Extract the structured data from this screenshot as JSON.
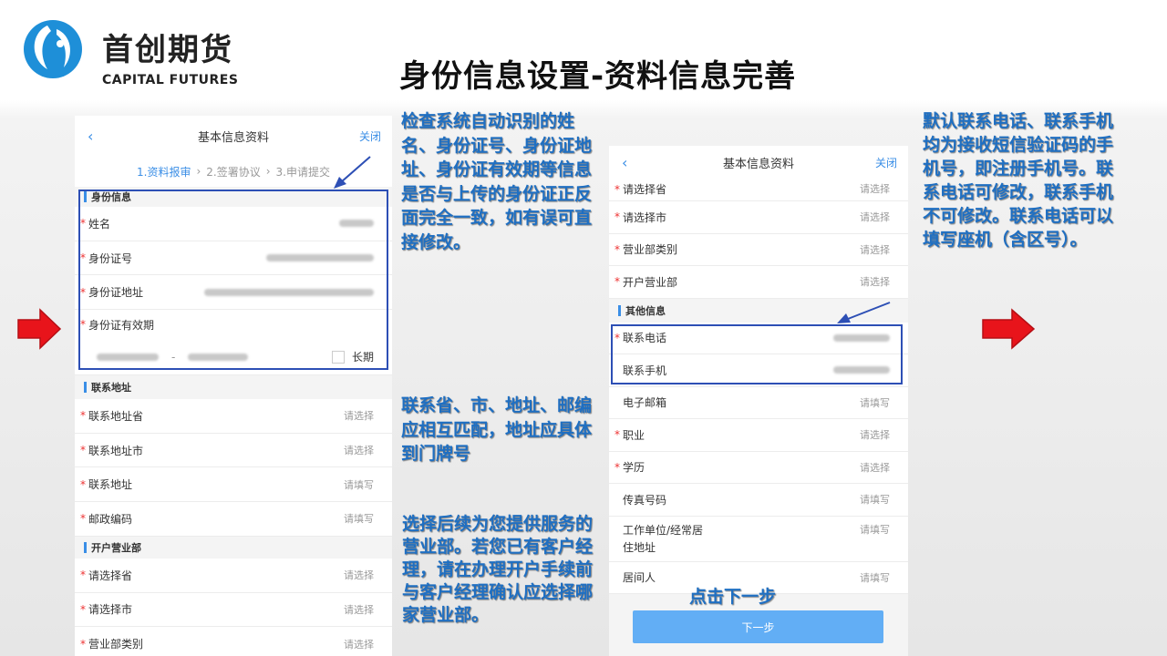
{
  "brand": {
    "name_cn": "首创期货",
    "name_en": "CAPITAL FUTURES"
  },
  "slide_title": "身份信息设置-资料信息完善",
  "phone_left": {
    "header": {
      "title": "基本信息资料",
      "close": "关闭"
    },
    "steps": [
      "1.资料报审",
      "2.签署协议",
      "3.申请提交"
    ],
    "identity_section": "身份信息",
    "identity_rows": [
      {
        "label": "姓名"
      },
      {
        "label": "身份证号"
      },
      {
        "label": "身份证地址"
      },
      {
        "label": "身份证有效期"
      }
    ],
    "long_term_label": "长期",
    "date_sep": "-",
    "contact_section": "联系地址",
    "contact_rows": [
      {
        "label": "联系地址省",
        "value": "请选择"
      },
      {
        "label": "联系地址市",
        "value": "请选择"
      },
      {
        "label": "联系地址",
        "value": "请填写"
      },
      {
        "label": "邮政编码",
        "value": "请填写"
      }
    ],
    "branch_section": "开户营业部",
    "branch_rows": [
      {
        "label": "请选择省",
        "value": "请选择"
      },
      {
        "label": "请选择市",
        "value": "请选择"
      },
      {
        "label": "营业部类别",
        "value": "请选择"
      }
    ]
  },
  "phone_right": {
    "header": {
      "title": "基本信息资料",
      "close": "关闭"
    },
    "top_rows": [
      {
        "label": "请选择省",
        "value": "请选择"
      },
      {
        "label": "请选择市",
        "value": "请选择"
      },
      {
        "label": "营业部类别",
        "value": "请选择"
      },
      {
        "label": "开户营业部",
        "value": "请选择"
      }
    ],
    "other_section": "其他信息",
    "phone_rows": [
      {
        "label": "联系电话",
        "required": true
      },
      {
        "label": "联系手机",
        "required": false
      }
    ],
    "more_rows": [
      {
        "label": "电子邮箱",
        "value": "请填写",
        "required": false
      },
      {
        "label": "职业",
        "value": "请选择",
        "required": true
      },
      {
        "label": "学历",
        "value": "请选择",
        "required": true
      },
      {
        "label": "传真号码",
        "value": "请填写",
        "required": false
      }
    ],
    "workplace": {
      "line1": "工作单位/经常居",
      "line2": "住地址",
      "value": "请填写"
    },
    "resident": {
      "label": "居间人",
      "value": "请填写"
    },
    "next_button": "下一步"
  },
  "annotations": {
    "identity_check": "检查系统自动识别的姓名、身份证号、身份证地址、身份证有效期等信息是否与上传的身份证正反面完全一致，如有误可直接修改。",
    "address_match": "联系省、市、地址、邮编应相互匹配，地址应具体到门牌号",
    "branch_choice": "选择后续为您提供服务的营业部。若您已有客户经理，请在办理开户手续前与客户经理确认应选择哪家营业部。",
    "phone_default": "默认联系电话、联系手机均为接收短信验证码的手机号，即注册手机号。联系电话可修改，联系手机不可修改。联系电话可以填写座机（含区号）。",
    "click_next": "点击下一步"
  },
  "colors": {
    "accent_blue": "#3a8ee6",
    "annotation_blue": "#1f6fc2",
    "box_border": "#2d4fb5",
    "arrow_red": "#e8141b",
    "button_blue": "#62aef5",
    "logo_blue": "#1e8fd8"
  }
}
